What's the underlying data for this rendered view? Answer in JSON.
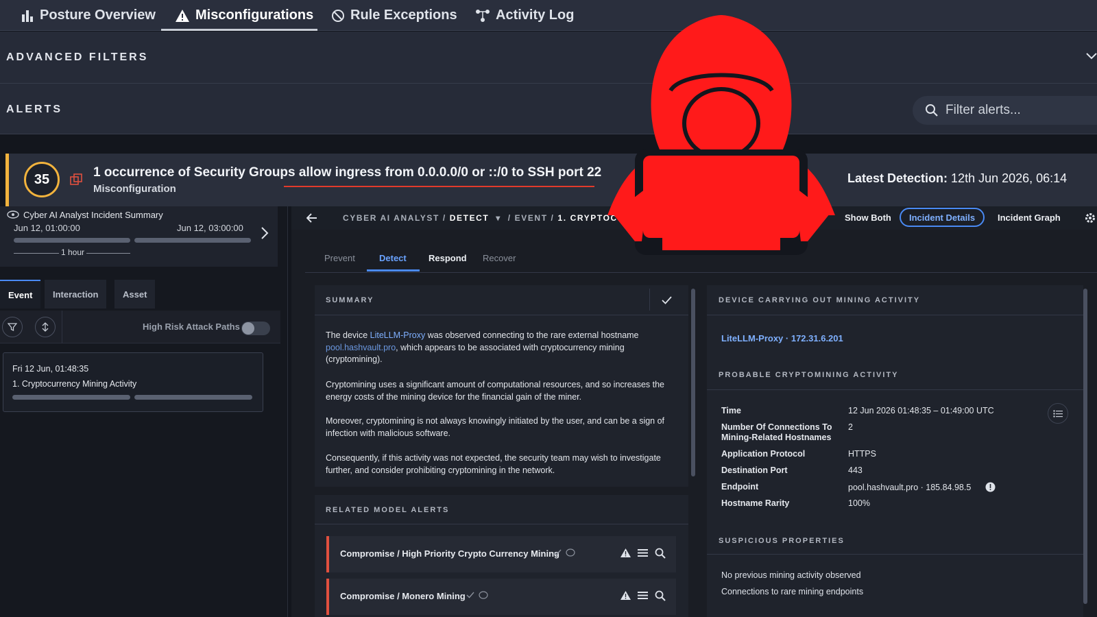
{
  "nav": {
    "tabs": [
      {
        "label": "Posture Overview",
        "icon": "bar-chart-icon"
      },
      {
        "label": "Misconfigurations",
        "icon": "warning-icon",
        "active": true
      },
      {
        "label": "Rule Exceptions",
        "icon": "no-entry-icon"
      },
      {
        "label": "Activity Log",
        "icon": "network-icon"
      }
    ]
  },
  "filters": {
    "title": "ADVANCED FILTERS"
  },
  "alerts_row": {
    "title": "ALERTS",
    "search_placeholder": "Filter alerts..."
  },
  "banner": {
    "score": "35",
    "title": "1 occurrence of Security Groups allow ingress from 0.0.0.0/0 or ::/0 to SSH port 22",
    "subtitle": "Misconfiguration",
    "latest_label": "Latest Detection:",
    "latest_value": "12th Jun 2026, 06:14",
    "accent_color": "#f2b33d"
  },
  "left": {
    "summary_title": "Cyber AI Analyst Incident Summary",
    "time_start": "Jun 12, 01:00:00",
    "time_end": "Jun 12, 03:00:00",
    "scale_label": "1 hour",
    "subtabs": [
      "Event",
      "Interaction",
      "Asset"
    ],
    "toggle_label": "High Risk Attack Paths",
    "event_date": "Fri 12 Jun, 01:48:35",
    "event_title": "1. Cryptocurrency Mining Activity"
  },
  "crumbs": {
    "part1": "CYBER AI ANALYST /",
    "part2": "DETECT",
    "part3": "/ EVENT /",
    "part4": "1. CRYPTOCU",
    "show_both": "Show Both",
    "incident_details": "Incident Details",
    "incident_graph": "Incident Graph"
  },
  "phase_tabs": [
    "Prevent",
    "Detect",
    "Respond",
    "Recover"
  ],
  "summary": {
    "title": "SUMMARY",
    "p1_a": "The device ",
    "p1_device": "LiteLLM-Proxy",
    "p1_b": " was observed connecting to the rare external hostname ",
    "p1_host": "pool.hashvault.pro",
    "p1_c": ", which appears to be associated with cryptocurrency mining (cryptomining).",
    "p2": "Cryptomining uses a significant amount of computational resources, and so increases the energy costs of the mining device for the financial gain of the miner.",
    "p3": "Moreover, cryptomining is not always knowingly initiated by the user, and can be a sign of infection with malicious software.",
    "p4": "Consequently, if this activity was not expected, the security team may wish to investigate further, and consider prohibiting cryptomining in the network."
  },
  "related": {
    "title": "RELATED MODEL ALERTS",
    "items": [
      "Compromise / High Priority Crypto Currency Mining",
      "Compromise / Monero Mining"
    ]
  },
  "device": {
    "title": "DEVICE CARRYING OUT MINING ACTIVITY",
    "name": "LiteLLM-Proxy · 172.31.6.201"
  },
  "probable": {
    "title": "PROBABLE CRYPTOMINING ACTIVITY",
    "rows": [
      {
        "key": "Time",
        "value": "12 Jun 2026 01:48:35 – 01:49:00 UTC"
      },
      {
        "key": "Number Of Connections To Mining-Related Hostnames",
        "value": "2"
      },
      {
        "key": "Application Protocol",
        "value": "HTTPS"
      },
      {
        "key": "Destination Port",
        "value": "443"
      },
      {
        "key": "Endpoint",
        "value": "pool.hashvault.pro · 185.84.98.5"
      },
      {
        "key": "Hostname Rarity",
        "value": "100%"
      }
    ]
  },
  "suspicious": {
    "title": "SUSPICIOUS PROPERTIES",
    "items": [
      "No previous mining activity observed",
      "Connections to rare mining endpoints"
    ]
  },
  "overlay": {
    "icon": "hacker-icon",
    "color": "#ff1a1a"
  }
}
